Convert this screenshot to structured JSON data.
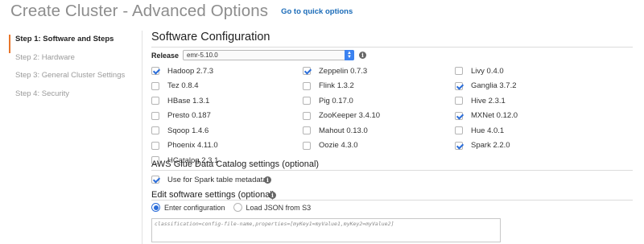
{
  "header": {
    "title": "Create Cluster - Advanced Options",
    "quick_link": "Go to quick options"
  },
  "steps": [
    {
      "label": "Step 1: Software and Steps",
      "active": true
    },
    {
      "label": "Step 2: Hardware",
      "active": false
    },
    {
      "label": "Step 3: General Cluster Settings",
      "active": false
    },
    {
      "label": "Step 4: Security",
      "active": false
    }
  ],
  "software": {
    "title": "Software Configuration",
    "release_label": "Release",
    "release_value": "emr-5.10.0"
  },
  "applications": [
    {
      "name": "Hadoop 2.7.3",
      "checked": true
    },
    {
      "name": "Zeppelin 0.7.3",
      "checked": true
    },
    {
      "name": "Livy 0.4.0",
      "checked": false
    },
    {
      "name": "Tez 0.8.4",
      "checked": false
    },
    {
      "name": "Flink 1.3.2",
      "checked": false
    },
    {
      "name": "Ganglia 3.7.2",
      "checked": true
    },
    {
      "name": "HBase 1.3.1",
      "checked": false
    },
    {
      "name": "Pig 0.17.0",
      "checked": false
    },
    {
      "name": "Hive 2.3.1",
      "checked": false
    },
    {
      "name": "Presto 0.187",
      "checked": false
    },
    {
      "name": "ZooKeeper 3.4.10",
      "checked": false
    },
    {
      "name": "MXNet 0.12.0",
      "checked": true
    },
    {
      "name": "Sqoop 1.4.6",
      "checked": false
    },
    {
      "name": "Mahout 0.13.0",
      "checked": false
    },
    {
      "name": "Hue 4.0.1",
      "checked": false
    },
    {
      "name": "Phoenix 4.11.0",
      "checked": false
    },
    {
      "name": "Oozie 4.3.0",
      "checked": false
    },
    {
      "name": "Spark 2.2.0",
      "checked": true
    },
    {
      "name": "HCatalog 2.3.1",
      "checked": false
    }
  ],
  "glue": {
    "title": "AWS Glue Data Catalog settings (optional)",
    "spark_label": "Use for Spark table metadata",
    "spark_checked": true
  },
  "edit_settings": {
    "title": "Edit software settings (optional)",
    "option_enter": "Enter configuration",
    "option_load": "Load JSON from S3",
    "config_text": "classification=config-file-name,properties=[myKey1=myValue1,myKey2=myValue2]"
  },
  "colors": {
    "accent": "#2b6dd9",
    "active_step_marker": "#e8762c",
    "link": "#1a6bb8"
  }
}
